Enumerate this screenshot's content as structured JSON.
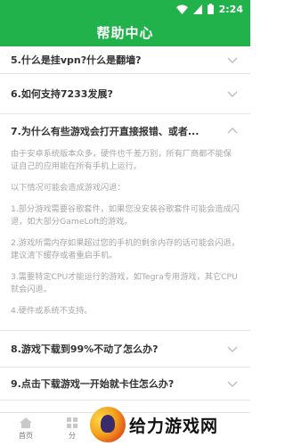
{
  "status_bar": {
    "time": "2:24",
    "icons": [
      "wifi-icon",
      "signal-icon",
      "battery-icon"
    ]
  },
  "app_bar": {
    "title": "帮助中心"
  },
  "faq": {
    "items": [
      {
        "question": "5.什么是挂vpn?什么是翻墙?",
        "expanded": false
      },
      {
        "question": "6.如何支持7233发展?",
        "expanded": false
      },
      {
        "question": "7.为什么有些游戏会打开直接报错、或者...",
        "expanded": true,
        "answer": [
          "由于安卓系统版本众多，硬件也千差万别，所有厂商都不能保证自己的应用能在所有手机上运行。",
          "以下情况可能会造成游戏闪退：",
          "1.部分游戏需要谷歌套件，如果您没安装谷歌套件可能会造成闪退，如大部分GameLoft的游戏。",
          "2.游戏所需内存如果超过您的手机的剩余内存的话可能会闪退，建议清下缓存或者重启手机。",
          "3.需要特定CPU才能运行的游戏，如Tegra专用游戏，其它CPU 就会闪退。",
          "4.硬件或系统不支持。"
        ]
      },
      {
        "question": "8.游戏下载到99%不动了怎么办?",
        "expanded": false
      },
      {
        "question": "9.点击下载游戏一开始就卡住怎么办?",
        "expanded": false
      }
    ]
  },
  "bottom_nav": {
    "tabs": [
      {
        "label": "首页",
        "icon": "home-icon"
      },
      {
        "label": "分",
        "icon": "category-icon"
      }
    ]
  },
  "watermark": {
    "text": "给力游戏网"
  },
  "colors": {
    "accent": "#21b24c",
    "question_text": "#333333",
    "answer_text": "#a7a7a7"
  }
}
